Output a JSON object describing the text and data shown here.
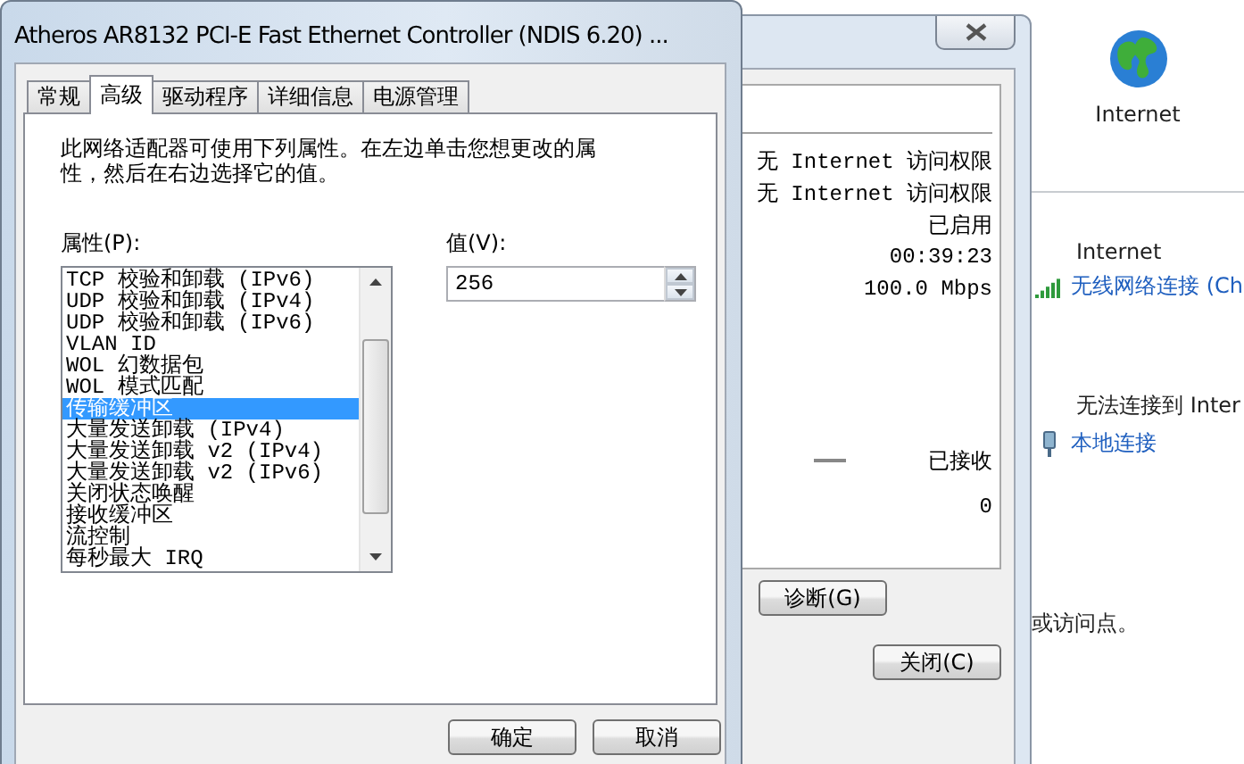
{
  "background_window": {
    "globe_label": "Internet",
    "sections": [
      {
        "title": "Internet",
        "link": "无线网络连接 (Ch",
        "kind": "wireless"
      },
      {
        "title": "无法连接到 Inter",
        "link": "本地连接",
        "kind": "wired"
      }
    ],
    "note": "或访问点。"
  },
  "status_dialog": {
    "rows": [
      "无 Internet 访问权限",
      "无 Internet 访问权限",
      "已启用",
      "00:39:23",
      "100.0 Mbps"
    ],
    "activity": {
      "label": "已接收",
      "value": "0"
    },
    "diagnose_button": "诊断(G)",
    "close_button": "关闭(C)"
  },
  "properties_dialog": {
    "title": "Atheros AR8132 PCI-E Fast Ethernet Controller (NDIS 6.20) ...",
    "tabs": [
      {
        "label": "常规",
        "selected": false
      },
      {
        "label": "高级",
        "selected": true
      },
      {
        "label": "驱动程序",
        "selected": false
      },
      {
        "label": "详细信息",
        "selected": false
      },
      {
        "label": "电源管理",
        "selected": false
      }
    ],
    "description": "此网络适配器可使用下列属性。在左边单击您想更改的属性，然后在右边选择它的值。",
    "property_label": "属性(P):",
    "properties": [
      {
        "label": "TCP 校验和卸载 (IPv6)",
        "selected": false
      },
      {
        "label": "UDP 校验和卸载 (IPv4)",
        "selected": false
      },
      {
        "label": "UDP 校验和卸载 (IPv6)",
        "selected": false
      },
      {
        "label": "VLAN ID",
        "selected": false
      },
      {
        "label": "WOL 幻数据包",
        "selected": false
      },
      {
        "label": "WOL 模式匹配",
        "selected": false
      },
      {
        "label": "传输缓冲区",
        "selected": true
      },
      {
        "label": "大量发送卸载 (IPv4)",
        "selected": false
      },
      {
        "label": "大量发送卸载 v2 (IPv4)",
        "selected": false
      },
      {
        "label": "大量发送卸载 v2 (IPv6)",
        "selected": false
      },
      {
        "label": "关闭状态唤醒",
        "selected": false
      },
      {
        "label": "接收缓冲区",
        "selected": false
      },
      {
        "label": "流控制",
        "selected": false
      },
      {
        "label": "每秒最大 IRQ",
        "selected": false
      }
    ],
    "value_label": "值(V):",
    "value": "256",
    "ok_button": "确定",
    "cancel_button": "取消"
  }
}
